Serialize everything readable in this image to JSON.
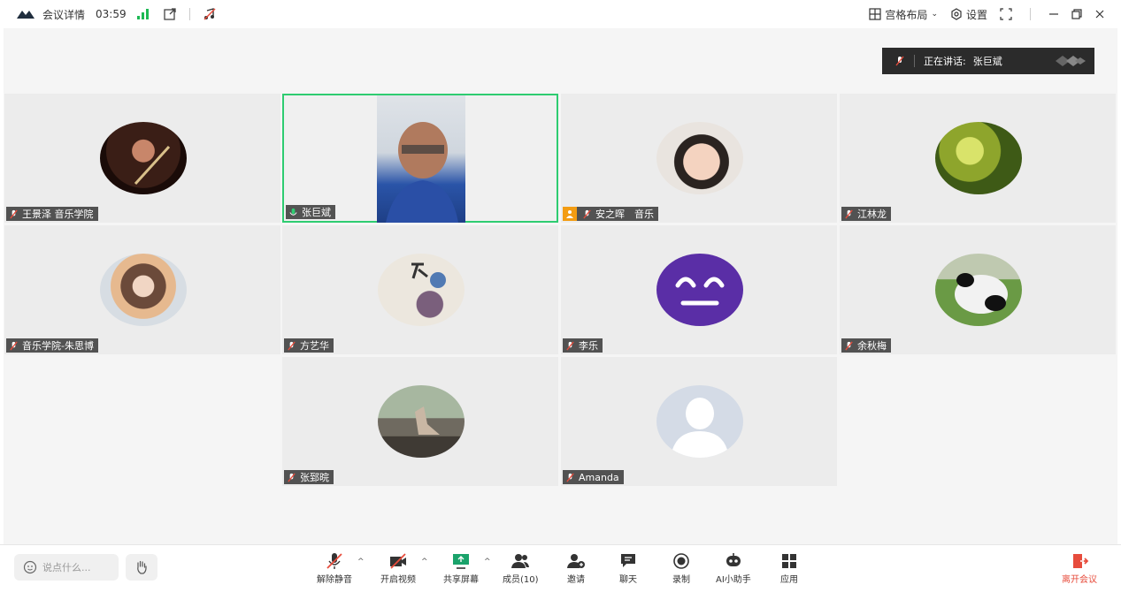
{
  "titlebar": {
    "title": "会议详情",
    "timer": "03:59",
    "layout_label": "宫格布局",
    "settings_label": "设置"
  },
  "speaking": {
    "label": "正在讲话:",
    "name": "张巨斌"
  },
  "participants": [
    {
      "name": "王景泽 音乐学院"
    },
    {
      "name": "张巨斌"
    },
    {
      "name": "安之晖　音乐"
    },
    {
      "name": "江林龙"
    },
    {
      "name": "音乐学院-朱思博"
    },
    {
      "name": "方艺华"
    },
    {
      "name": "李乐"
    },
    {
      "name": "余秋梅"
    },
    {
      "name": "张郅晥"
    },
    {
      "name": "Amanda"
    }
  ],
  "chat": {
    "placeholder": "说点什么..."
  },
  "toolbar": {
    "unmute": "解除静音",
    "start_video": "开启视频",
    "share_screen": "共享屏幕",
    "members": "成员(10)",
    "invite": "邀请",
    "chat": "聊天",
    "record": "录制",
    "ai_assistant": "AI小助手",
    "apps": "应用",
    "leave": "离开会议"
  },
  "colors": {
    "active_border": "#2ecc71",
    "signal": "#1db954",
    "leave": "#e74c3c",
    "host_badge": "#f39c12"
  }
}
